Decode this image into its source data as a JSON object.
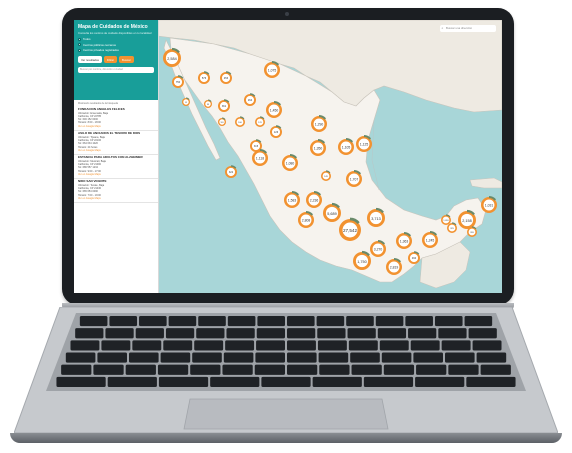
{
  "sidebar": {
    "title": "Mapa de Cuidados de México",
    "subtitle": "Consulta los centros de cuidado disponibles en tu localidad",
    "filters": [
      "Todos",
      "Centros públicos cercanos",
      "Centros privados registrados"
    ],
    "buttons": {
      "primary": "Ver resultados",
      "secondary": "Filtrar",
      "tertiary": "Buscar"
    },
    "search_placeholder": "Buscar por nombre, dirección o ciudad",
    "results_count": "Mostrando resultados de la búsqueda",
    "entries": [
      {
        "name": "FUNDACION ANGELES FELICES",
        "lines": [
          "Ubicación: Ensenada, Baja",
          "California, CP 22785",
          "Tel: 646 152 0000",
          "Horario: 8:00 - 18:00"
        ],
        "link": "Ver en Google Maps"
      },
      {
        "name": "ASILO DE ANCIANOS EL TESORO DE DIOS",
        "lines": [
          "Ubicación: Tijuana, Baja",
          "California, CP 22106",
          "Tel: 664 634 1020",
          "Horario: 24 horas"
        ],
        "link": "Ver en Google Maps"
      },
      {
        "name": "ESTANCIA PARA ADULTOS CON ALZHEIMER",
        "lines": [
          "Ubicación: Mexicali, Baja",
          "California, CP 21000",
          "Tel: 686 557 1234",
          "Horario: 9:00 - 17:00"
        ],
        "link": "Ver en Google Maps"
      },
      {
        "name": "NIDO SAN VICENTE",
        "lines": [
          "Ubicación: Tecate, Baja",
          "California, CP 21430",
          "Tel: 665 654 0090",
          "Horario: 7:00 - 19:00"
        ],
        "link": "Ver en Google Maps"
      }
    ]
  },
  "map": {
    "search_placeholder": "Buscar una dirección",
    "colors": {
      "ocean": "#a8d6d8",
      "land": "#f2efe9",
      "marker": "#f29230",
      "accent": "#189e99"
    },
    "clusters": [
      {
        "label": "2,584"
      },
      {
        "label": "750"
      },
      {
        "label": "576"
      },
      {
        "label": "453"
      },
      {
        "label": "1,075"
      },
      {
        "label": "53"
      },
      {
        "label": "88"
      },
      {
        "label": "361"
      },
      {
        "label": "264"
      },
      {
        "label": "1,450"
      },
      {
        "label": "100"
      },
      {
        "label": "170"
      },
      {
        "label": "126"
      },
      {
        "label": "593"
      },
      {
        "label": "1,290"
      },
      {
        "label": "315"
      },
      {
        "label": "1,118"
      },
      {
        "label": "1,080"
      },
      {
        "label": "1,350"
      },
      {
        "label": "1,105"
      },
      {
        "label": "1,125"
      },
      {
        "label": "322"
      },
      {
        "label": "1,707"
      },
      {
        "label": "149"
      },
      {
        "label": "1,583"
      },
      {
        "label": "2,236"
      },
      {
        "label": "2,808"
      },
      {
        "label": "5,689"
      },
      {
        "label": "27,542"
      },
      {
        "label": "3,713"
      },
      {
        "label": "2,158"
      },
      {
        "label": "1,031"
      },
      {
        "label": "1,363"
      },
      {
        "label": "1,245"
      },
      {
        "label": "3,270"
      },
      {
        "label": "1,750"
      },
      {
        "label": "2,819"
      },
      {
        "label": "1,053"
      },
      {
        "label": "329"
      },
      {
        "label": "269"
      },
      {
        "label": "460"
      }
    ]
  }
}
